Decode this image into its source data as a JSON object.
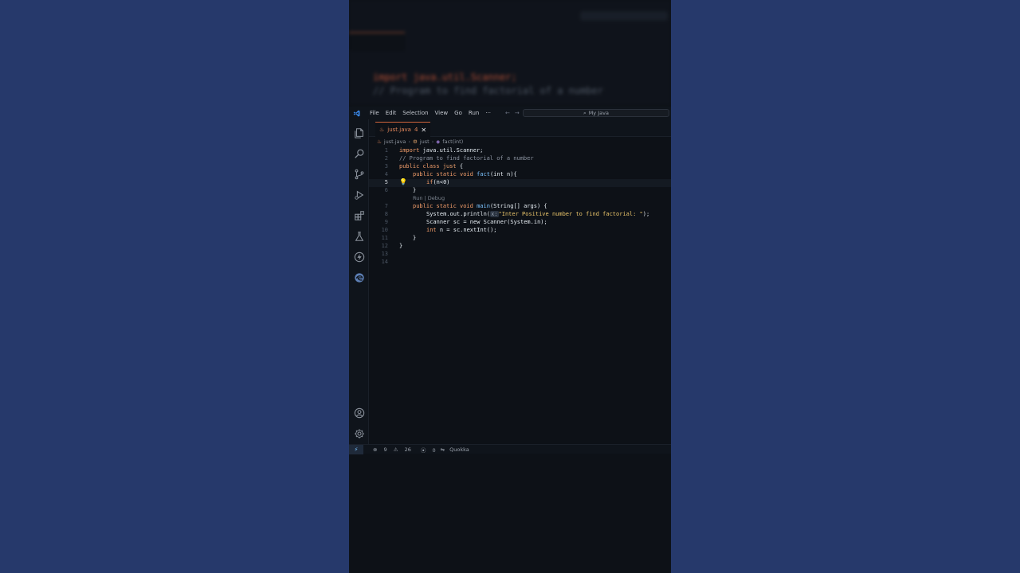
{
  "window": {
    "menu": [
      "File",
      "Edit",
      "Selection",
      "View",
      "Go",
      "Run",
      "···"
    ],
    "search_label": "My Java"
  },
  "tab": {
    "filename": "just.java",
    "problems_count": "4",
    "close_glyph": "✕"
  },
  "breadcrumb": {
    "file": "just.java",
    "class": "just",
    "method": "fact(int)"
  },
  "editor": {
    "line_numbers": [
      "1",
      "2",
      "3",
      "4",
      "5",
      "6",
      "7",
      "8",
      "9",
      "10",
      "11",
      "12",
      "13",
      "14"
    ],
    "active_line": "5",
    "codelens": "Run | Debug"
  },
  "code": {
    "l1_kw": "import",
    "l1_rest": " java.util.Scanner;",
    "l2": "// Program to find factorial of a number",
    "l3_kw": "public class",
    "l3_name": " just",
    "l3_rest": " {",
    "l4_kw": "public static void",
    "l4_fn": " fact",
    "l4_args": "(int n){",
    "l5_kw": "if",
    "l5_rest": "(n<0)",
    "l6": "}",
    "l7_kw": "public static void",
    "l7_fn": " main",
    "l7_args": "(String[] args) {",
    "l8_pre": "System.out.println(",
    "l8_hint": "x:",
    "l8_str": "\"Inter Positive number to find factorial: \"",
    "l8_end": ");",
    "l9": "Scanner sc = new Scanner(System.in);",
    "l10_kw": "int",
    "l10_rest": " n = sc.nextInt();",
    "l11": "}",
    "l12": "}"
  },
  "statusbar": {
    "errors": "9",
    "warnings": "26",
    "ports": "0",
    "extension": "Quokka"
  },
  "background_blur": {
    "line1": "import java.util.Scanner;",
    "line2": "// Program to find factorial of a number"
  },
  "colors": {
    "accent": "#3c8cf0",
    "tab_modified": "#e2875b",
    "background": "#26396b",
    "editor_bg": "#0d1117"
  }
}
